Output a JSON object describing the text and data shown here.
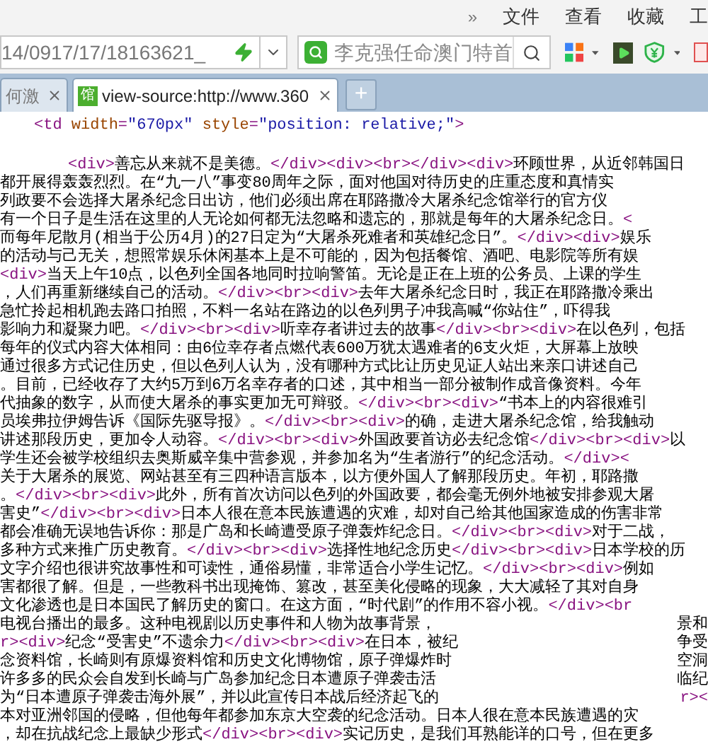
{
  "menu": {
    "overflow": "»",
    "items": [
      "文件",
      "查看",
      "收藏",
      "工"
    ]
  },
  "address": {
    "value": "14/0917/17/18163621_"
  },
  "search": {
    "value": "李克强任命澳门特首"
  },
  "tabs": [
    {
      "label": "何激",
      "selected": false
    },
    {
      "label": "view-source:http://www.360",
      "selected": true,
      "favicon": "馆"
    }
  ],
  "new_tab": "+",
  "source": {
    "td_line": "<td width=\"670px\" style=\"position: relative;\">",
    "lines": [
      [
        "<div>善忘从来就不是美德。</div><div><br></div><div>环顾世界，从近邻韩国日"
      ],
      [
        "都开展得轰轰烈烈。在“九一八”事变80周年之际，面对他国对待历史的庄重态度和真情实"
      ],
      [
        "列政要不会选择大屠杀纪念日出访，他们必须出席在耶路撒冷大屠杀纪念馆举行的官方仪"
      ],
      [
        "有一个日子是生活在这里的人无论如何都无法忽略和遗忘的，那就是每年的大屠杀纪念日。<"
      ],
      [
        "而每年尼散月(相当于公历4月)的27日定为“大屠杀死难者和英雄纪念日”。</div><div>娱乐"
      ],
      [
        "的活动与己无关，想照常娱乐休闲基本上是不可能的，因为包括餐馆、酒吧、电影院等所有娱"
      ],
      [
        "<div>当天上午10点，以色列全国各地同时拉响警笛。无论是正在上班的公务员、上课的学生"
      ],
      [
        "，人们再重新继续自己的活动。</div><br><div>去年大屠杀纪念日时，我正在耶路撒冷乘出"
      ],
      [
        "急忙拎起相机跑去路口拍照，不料一名站在路边的以色列男子冲我高喊“你站住”，吓得我"
      ],
      [
        "影响力和凝聚力吧。</div><br><div>听幸存者讲过去的故事</div><br><div>在以色列，包括"
      ],
      [
        "每年的仪式内容大体相同：由6位幸存者点燃代表600万犹太遇难者的6支火炬，大屏幕上放映"
      ],
      [
        "通过很多方式记住历史，但以色列人认为，没有哪种方式比让历史见证人站出来亲口讲述自己"
      ],
      [
        "。目前，已经收存了大约5万到6万名幸存者的口述，其中相当一部分被制作成音像资料。今年"
      ],
      [
        "代抽象的数字，从而使大屠杀的事实更加无可辩驳。</div><br><div>“书本上的内容很难引"
      ],
      [
        "员埃弗拉伊姆告诉《国际先驱导报》。</div><br><div>的确，走进大屠杀纪念馆，给我触动"
      ],
      [
        "讲述那段历史，更加令人动容。</div><br><div>外国政要首访必去纪念馆</div><br><div>以"
      ],
      [
        "学生还会被学校组织去奥斯威辛集中营参观，并参加名为“生者游行”的纪念活动。</div><"
      ],
      [
        "关于大屠杀的展览、网站甚至有三四种语言版本，以方便外国人了解那段历史。年初，耶路撒"
      ],
      [
        "。</div><br><div>此外，所有首次访问以色列的外国政要，都会毫无例外地被安排参观大屠"
      ],
      [
        "害史”</div><br><div>日本人很在意本民族遭遇的灾难，却对自己给其他国家造成的伤害非常"
      ],
      [
        "都会准确无误地告诉你：那是广岛和长崎遭受原子弹轰炸纪念日。</div><br><div>对于二战，"
      ],
      [
        "多种方式来推广历史教育。</div><br><div>选择性地纪念历史</div><br><div>日本学校的历"
      ],
      [
        "文字介绍也很讲究故事性和可读性，通俗易懂，非常适合小学生记忆。</div><br><div>例如"
      ],
      [
        "害都很了解。但是，一些教科书出现掩饰、篡改，甚至美化侵略的现象，大大减轻了其对自身"
      ],
      [
        "文化渗透也是日本国民了解历史的窗口。在这方面，“时代剧”的作用不容小视。</div><br"
      ],
      [
        "电视台播出的最多。这种电视剧以历史事件和人物为故事背景，",
        "景和"
      ],
      [
        "r><div>纪念“受害史”不遗余力</div><br><div>在日本，被纪",
        "争受"
      ],
      [
        "念资料馆，长崎则有原爆资料馆和历史文化博物馆，原子弹爆炸时",
        "空洞"
      ],
      [
        "许多多的民众会自发到长崎与广岛参加纪念日本遭原子弹袭击活",
        "临纪"
      ],
      [
        "为“日本遭原子弹袭击海外展”，并以此宣传日本战后经济起飞的",
        "r><"
      ],
      [
        "本对亚洲邻国的侵略，但他每年都参加东京大空袭的纪念活动。日本人很在意本民族遭遇的灾"
      ],
      [
        "，却在抗战纪念上最缺少形式</div><br><div>实记历史，是我们耳熟能详的口号，但在更多"
      ]
    ]
  }
}
